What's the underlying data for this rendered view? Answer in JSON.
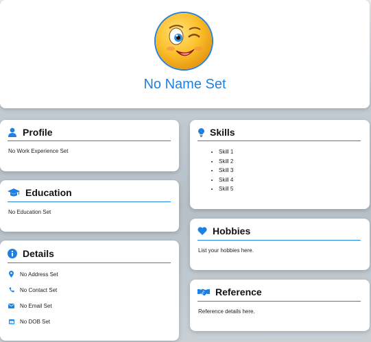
{
  "header": {
    "name": "No Name Set",
    "avatar_icon": "winking-emoji-avatar"
  },
  "profile": {
    "title": "Profile",
    "icon": "user-icon",
    "text": "No Work Experience Set"
  },
  "education": {
    "title": "Education",
    "icon": "graduation-cap-icon",
    "text": "No Education Set"
  },
  "details": {
    "title": "Details",
    "icon": "info-icon",
    "address": "No Address Set",
    "contact": "No Contact Set",
    "email": "No Email Set",
    "dob": "No DOB Set"
  },
  "skills": {
    "title": "Skills",
    "icon": "lightbulb-icon",
    "items": [
      "Skill 1",
      "Skill 2",
      "Skill 3",
      "Skill 4",
      "Skill 5"
    ]
  },
  "hobbies": {
    "title": "Hobbies",
    "icon": "heart-icon",
    "text": "List your hobbies here."
  },
  "reference": {
    "title": "Reference",
    "icon": "handshake-icon",
    "text": "Reference details here."
  },
  "colors": {
    "accent": "#1e80e0",
    "card": "#ffffff"
  }
}
